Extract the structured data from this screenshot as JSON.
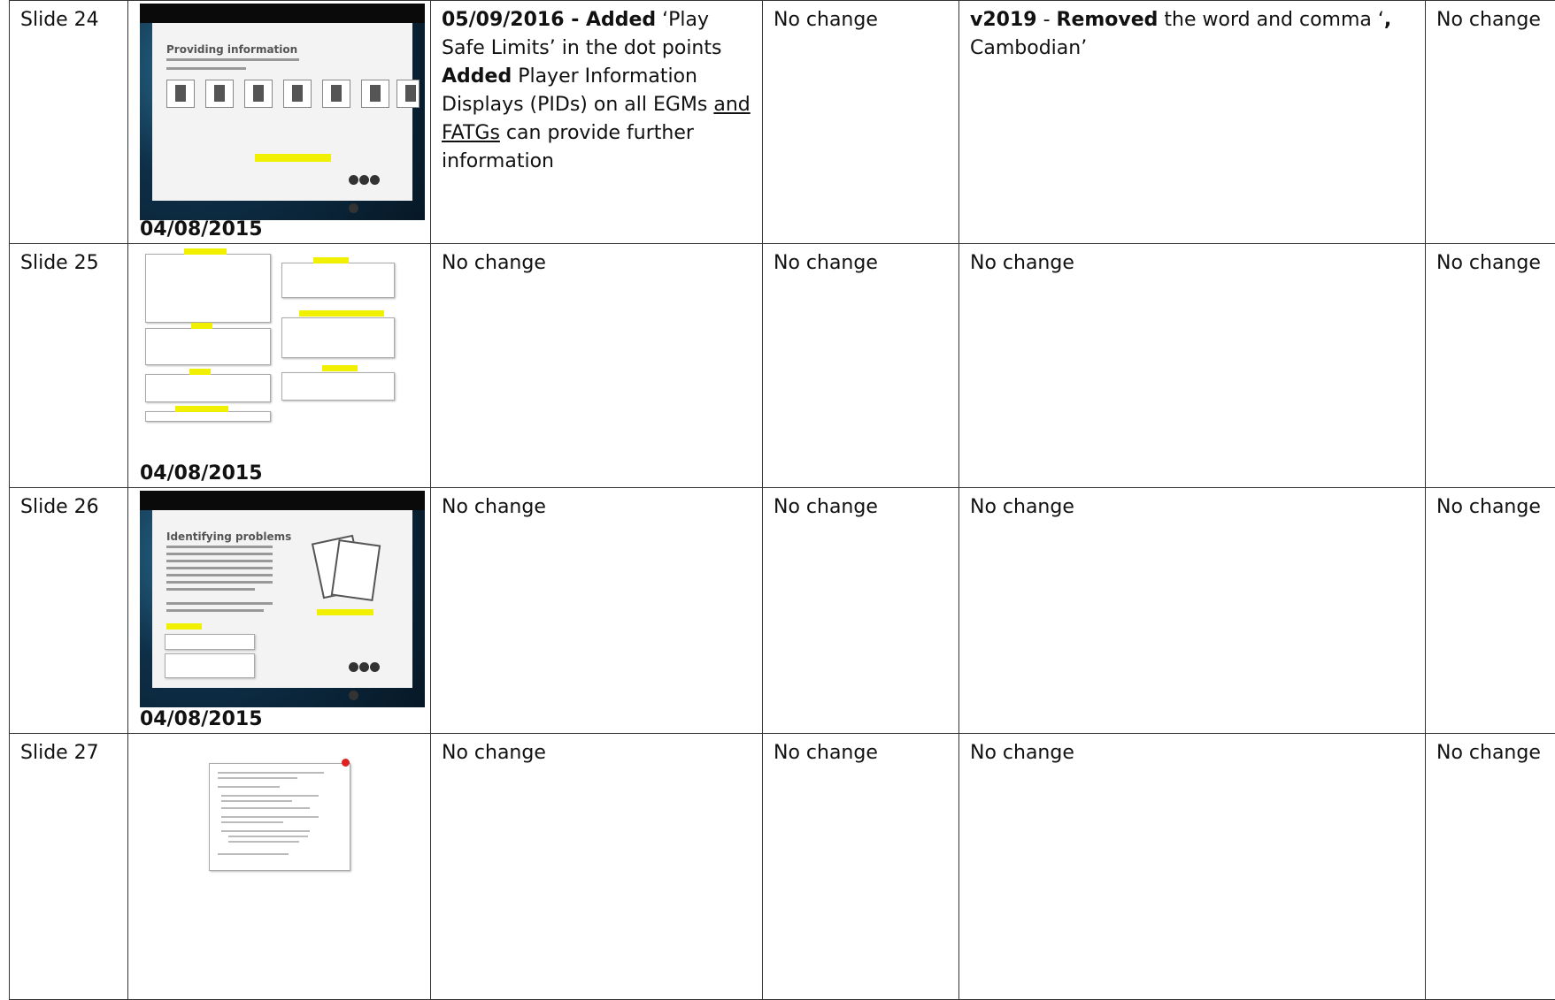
{
  "rows": [
    {
      "slide": "Slide 24",
      "thumb_date": "04/08/2015",
      "col3_parts": [
        {
          "t": "05/09/2016 - Added",
          "b": true
        },
        {
          "t": " ‘Play Safe Limits’ in the dot points "
        },
        {
          "t": "Added",
          "b": true
        },
        {
          "t": " Player Information Displays (PIDs) on all EGMs "
        },
        {
          "t": "and FATGs",
          "u": true
        },
        {
          "t": " can provide further information"
        }
      ],
      "col4": "No change",
      "col5_parts": [
        {
          "t": "v2019",
          "b": true
        },
        {
          "t": " - "
        },
        {
          "t": "Removed",
          "b": true
        },
        {
          "t": " the word and comma ‘"
        },
        {
          "t": ",",
          "b": true
        },
        {
          "t": " Cambodian’"
        }
      ],
      "col6": "No change"
    },
    {
      "slide": "Slide 25",
      "thumb_date": "04/08/2015",
      "col3_parts": [
        {
          "t": "No change"
        }
      ],
      "col4": "No change",
      "col5_parts": [
        {
          "t": "No change"
        }
      ],
      "col6": "No change"
    },
    {
      "slide": "Slide 26",
      "thumb_date": "04/08/2015",
      "col3_parts": [
        {
          "t": "No change"
        }
      ],
      "col4": "No change",
      "col5_parts": [
        {
          "t": "No change"
        }
      ],
      "col6": "No change"
    },
    {
      "slide": "Slide 27",
      "thumb_date": "",
      "col3_parts": [
        {
          "t": "No change"
        }
      ],
      "col4": "No change",
      "col5_parts": [
        {
          "t": "No change"
        }
      ],
      "col6": "No change"
    }
  ],
  "thumbs": {
    "s24_title": "Providing information",
    "s26_title": "Identifying problems"
  }
}
